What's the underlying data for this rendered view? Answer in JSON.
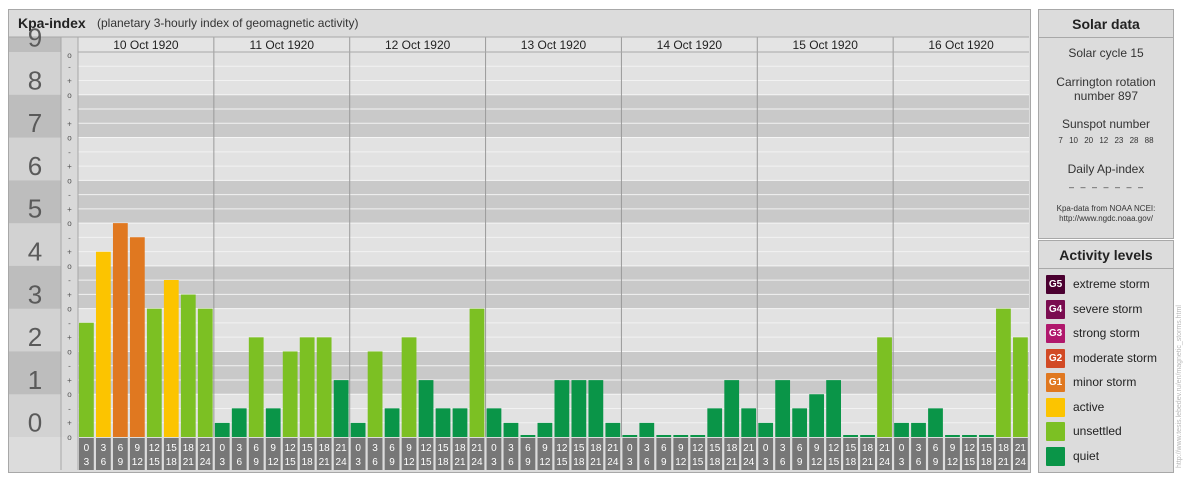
{
  "title": {
    "main": "Kpa-index",
    "sub": "(planetary 3-hourly index of geomagnetic activity)"
  },
  "chart_data": {
    "type": "bar",
    "ylim": [
      0,
      9
    ],
    "y_ticks": [
      "0",
      "1",
      "2",
      "3",
      "4",
      "5",
      "6",
      "7",
      "8",
      "9"
    ],
    "minor_ticks": [
      "o",
      "+",
      "-"
    ],
    "days": [
      "10 Oct 1920",
      "11 Oct 1920",
      "12 Oct 1920",
      "13 Oct 1920",
      "14 Oct 1920",
      "15 Oct 1920",
      "16 Oct 1920"
    ],
    "hour_labels_top": [
      "0",
      "3",
      "6",
      "9",
      "12",
      "15",
      "18",
      "21"
    ],
    "hour_labels_bottom": [
      "3",
      "6",
      "9",
      "12",
      "15",
      "18",
      "21",
      "24"
    ],
    "values": [
      2.67,
      4.33,
      5.0,
      4.67,
      3.0,
      3.67,
      3.33,
      3.0,
      0.33,
      0.67,
      2.33,
      0.67,
      2.0,
      2.33,
      2.33,
      1.33,
      0.33,
      2.0,
      0.67,
      2.33,
      1.33,
      0.67,
      0.67,
      3.0,
      0.67,
      0.33,
      0.0,
      0.33,
      1.33,
      1.33,
      1.33,
      0.33,
      0.0,
      0.33,
      0.0,
      0.0,
      0.0,
      0.67,
      1.33,
      0.67,
      0.33,
      1.33,
      0.67,
      1.0,
      1.33,
      0.0,
      0.0,
      2.33,
      0.33,
      0.33,
      0.67,
      0.0,
      0.0,
      0.0,
      3.0,
      2.33
    ],
    "legend": [
      "active",
      "unsettled",
      "quiet"
    ]
  },
  "colors": {
    "quiet": "#0a9548",
    "unsettled": "#7cc023",
    "active": "#fcc400",
    "g1": "#e07820",
    "g2": "#d24a25",
    "g3": "#b0186c",
    "g4": "#7a0c50",
    "g5": "#4a0030"
  },
  "solar": {
    "title": "Solar data",
    "cycle": "Solar cycle 15",
    "carrington_line1": "Carrington rotation",
    "carrington_line2": "number 897",
    "sunspot_label": "Sunspot number",
    "sunspot_values": "7 10 20 12 23 28 88",
    "ap_label": "Daily Ap-index",
    "ap_values": "– – – – – – –",
    "source_line1": "Kpa-data from NOAA NCEI:",
    "source_line2": "http://www.ngdc.noaa.gov/"
  },
  "activity": {
    "title": "Activity levels",
    "levels": [
      {
        "badge": "G5",
        "label": "extreme storm",
        "color": "#4a0030"
      },
      {
        "badge": "G4",
        "label": "severe storm",
        "color": "#7a0c50"
      },
      {
        "badge": "G3",
        "label": "strong storm",
        "color": "#b0186c"
      },
      {
        "badge": "G2",
        "label": "moderate storm",
        "color": "#d24a25"
      },
      {
        "badge": "G1",
        "label": "minor storm",
        "color": "#e07820"
      },
      {
        "badge": "",
        "label": "active",
        "color": "#fcc400"
      },
      {
        "badge": "",
        "label": "unsettled",
        "color": "#7cc023"
      },
      {
        "badge": "",
        "label": "quiet",
        "color": "#0a9548"
      }
    ]
  },
  "credit": "http://www.tesis.lebedev.ru/en/magnetic_storms.html"
}
